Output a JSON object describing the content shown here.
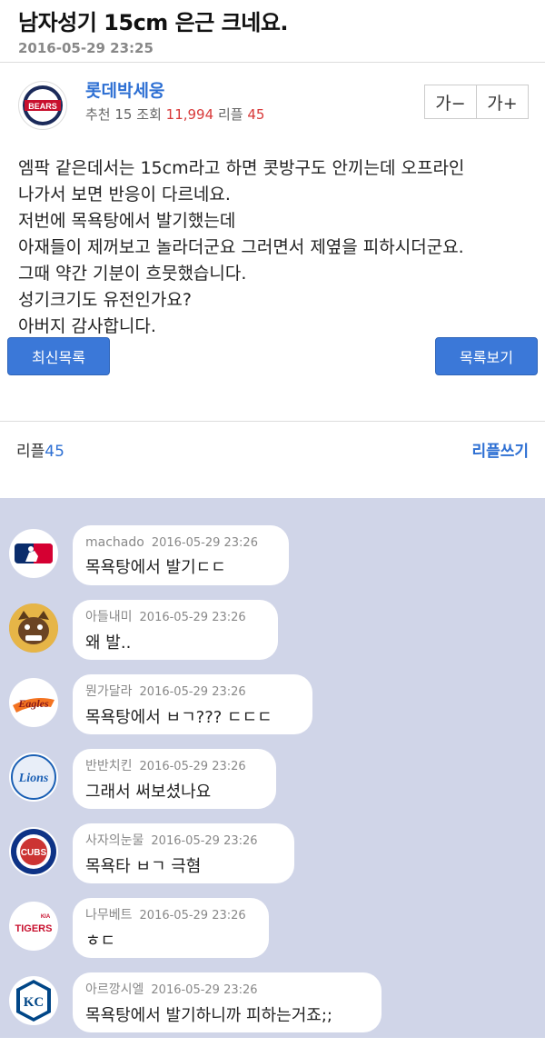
{
  "post": {
    "title": "남자성기 15cm 은근 크네요.",
    "date": "2016-05-29 23:25"
  },
  "author": {
    "avatar_text": "BEARS",
    "name": "롯데박세웅",
    "recommend_label": "추천",
    "recommend": "15",
    "views_label": "조회",
    "views": "11,994",
    "replies_label": "리플",
    "replies": "45"
  },
  "font_controls": {
    "decrease": "가−",
    "increase": "가+"
  },
  "body_lines": [
    "엠팍 같은데서는 15cm라고 하면 콧방구도 안끼는데 오프라인",
    "나가서 보면 반응이 다르네요.",
    "저번에 목욕탕에서 발기했는데",
    "아재들이 제꺼보고 놀라더군요 그러면서 제옆을 피하시더군요.",
    "그때 약간 기분이 흐뭇했습니다.",
    "성기크기도 유전인가요?",
    "아버지 감사합니다."
  ],
  "nav": {
    "latest": "최신목록",
    "list": "목록보기"
  },
  "reply_section": {
    "label": "리플",
    "count": "45",
    "write": "리플쓰기"
  },
  "comments": [
    {
      "user": "machado",
      "date": "2016-05-29 23:26",
      "text": "목욕탕에서 발기ㄷㄷ",
      "avatar": "mlb-logo"
    },
    {
      "user": "아들내미",
      "date": "2016-05-29 23:26",
      "text": "왜 발..",
      "avatar": "bulldog-mascot"
    },
    {
      "user": "뭔가달라",
      "date": "2016-05-29 23:26",
      "text": "목욕탕에서 ㅂㄱ??? ㄷㄷㄷ",
      "avatar": "eagles-logo"
    },
    {
      "user": "반반치킨",
      "date": "2016-05-29 23:26",
      "text": "그래서 써보셨나요",
      "avatar": "lions-logo"
    },
    {
      "user": "사자의눈물",
      "date": "2016-05-29 23:26",
      "text": "목욕타 ㅂㄱ 극혐",
      "avatar": "cubs-logo"
    },
    {
      "user": "나무베트",
      "date": "2016-05-29 23:26",
      "text": "ㅎㄷ",
      "avatar": "tigers-logo"
    },
    {
      "user": "아르깡시엘",
      "date": "2016-05-29 23:26",
      "text": "목욕탕에서 발기하니까 피하는거죠;;",
      "avatar": "kc-logo"
    }
  ],
  "logo_text": {
    "eagles": "Eagles",
    "lions": "Lions",
    "cubs": "CUBS",
    "tigers": "TIGERS",
    "tigers_top": "KIA",
    "kc": "KC"
  },
  "colors": {
    "accent": "#2d6fd3",
    "button": "#3b78d8",
    "highlight": "#d83a3a",
    "comments_bg": "#d0d5e8"
  }
}
